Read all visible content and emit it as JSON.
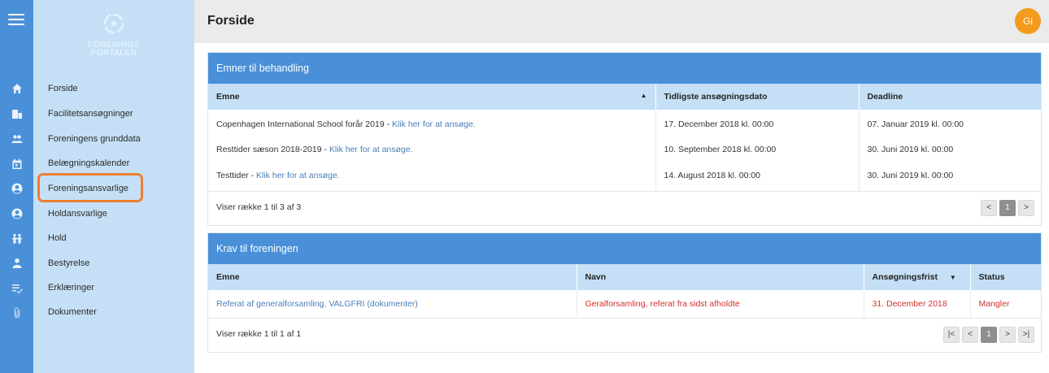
{
  "header": {
    "page_title": "Forside",
    "avatar_initials": "Gi"
  },
  "logo": {
    "line1": "FORENINGS",
    "line2": "PORTALEN"
  },
  "sidebar": {
    "items": [
      {
        "label": "Forside",
        "icon": "home-icon"
      },
      {
        "label": "Facilitetsansøgninger",
        "icon": "building-icon"
      },
      {
        "label": "Foreningens grunddata",
        "icon": "users-icon"
      },
      {
        "label": "Belægningskalender",
        "icon": "calendar-icon"
      },
      {
        "label": "Foreningsansvarlige",
        "icon": "user-circle-icon",
        "highlighted": true
      },
      {
        "label": "Holdansvarlige",
        "icon": "user-circle-icon"
      },
      {
        "label": "Hold",
        "icon": "team-icon"
      },
      {
        "label": "Bestyrelse",
        "icon": "person-icon"
      },
      {
        "label": "Erklæringer",
        "icon": "list-check-icon"
      },
      {
        "label": "Dokumenter",
        "icon": "paperclip-icon"
      }
    ]
  },
  "panel1": {
    "title": "Emner til behandling",
    "columns": [
      "Emne",
      "Tidligste ansøgningsdato",
      "Deadline"
    ],
    "rows": [
      {
        "emne": "Copenhagen International School forår 2019 - ",
        "link": "Klik her for at ansøge.",
        "date": "17. December 2018 kl. 00:00",
        "deadline": "07. Januar 2019 kl. 00:00"
      },
      {
        "emne": "Resttider sæson 2018-2019 - ",
        "link": "Klik her for at ansøge.",
        "date": "10. September 2018 kl. 00:00",
        "deadline": "30. Juni 2019 kl. 00:00"
      },
      {
        "emne": "Testtider - ",
        "link": "Klik her for at ansøge.",
        "date": "14. August 2018 kl. 00:00",
        "deadline": "30. Juni 2019 kl. 00:00"
      }
    ],
    "footer_info": "Viser række 1 til 3 af 3",
    "pager": {
      "prev": "<",
      "page": "1",
      "next": ">"
    }
  },
  "panel2": {
    "title": "Krav til foreningen",
    "columns": [
      "Emne",
      "Navn",
      "Ansøgningsfrist",
      "Status"
    ],
    "rows": [
      {
        "emne": "Referat af generalforsamling, VALGFRI (dokumenter)",
        "navn": "Geralforsamling, referat fra sidst afholdte",
        "frist": "31. December 2018",
        "status": "Mangler"
      }
    ],
    "footer_info": "Viser række 1 til 1 af 1",
    "pager": {
      "first": "|<",
      "prev": "<",
      "page": "1",
      "next": ">",
      "last": ">|"
    }
  },
  "colors": {
    "primary": "#4a90d9",
    "sidebar_bg": "#c5e0f6",
    "avatar": "#f29b1d",
    "highlight": "#ed7d31",
    "alert": "#d0312d"
  }
}
